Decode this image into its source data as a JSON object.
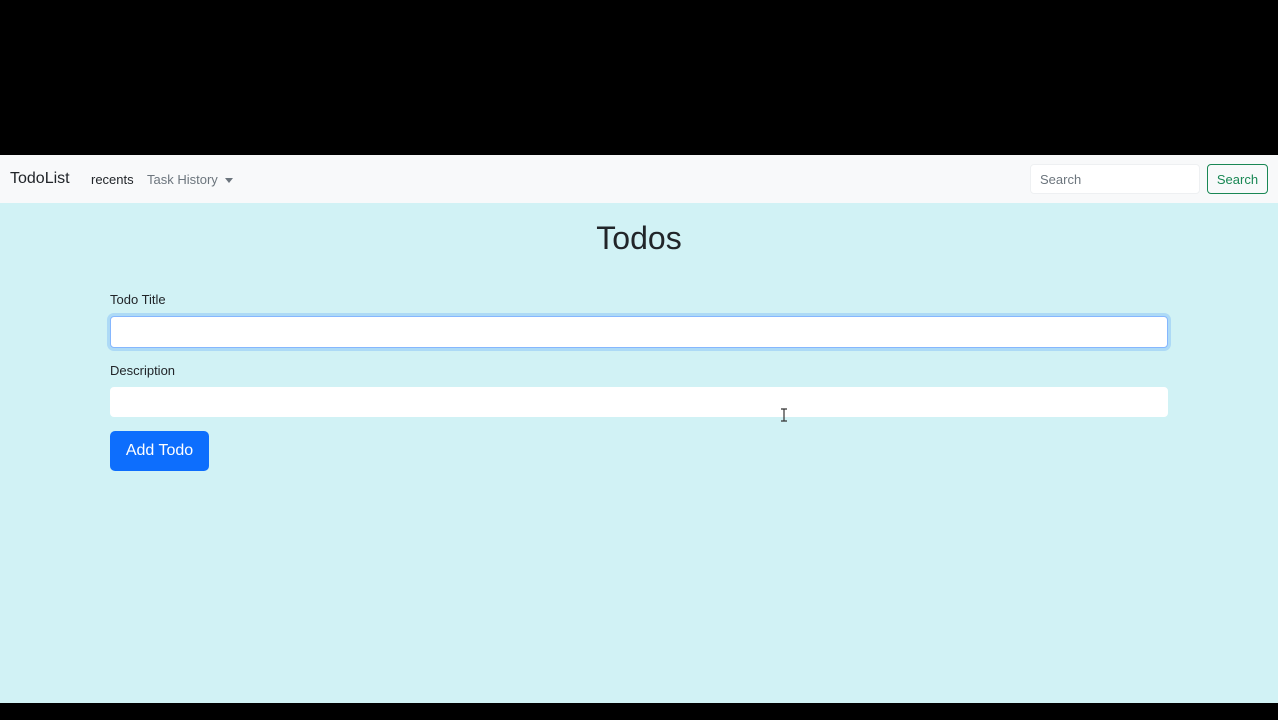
{
  "navbar": {
    "brand": "TodoList",
    "links": {
      "recents": "recents",
      "task_history": "Task History"
    },
    "search": {
      "placeholder": "Search",
      "value": "",
      "button_label": "Search"
    }
  },
  "main": {
    "title": "Todos",
    "form": {
      "title_label": "Todo Title",
      "title_value": "",
      "description_label": "Description",
      "description_value": "",
      "submit_label": "Add Todo"
    }
  },
  "icons": {
    "dropdown": "chevron-down-icon",
    "pointer": "text-cursor-icon"
  },
  "colors": {
    "navbar_bg": "#f8f9fa",
    "main_bg": "#d1f2f5",
    "primary": "#0d6efd",
    "success": "#198754"
  }
}
